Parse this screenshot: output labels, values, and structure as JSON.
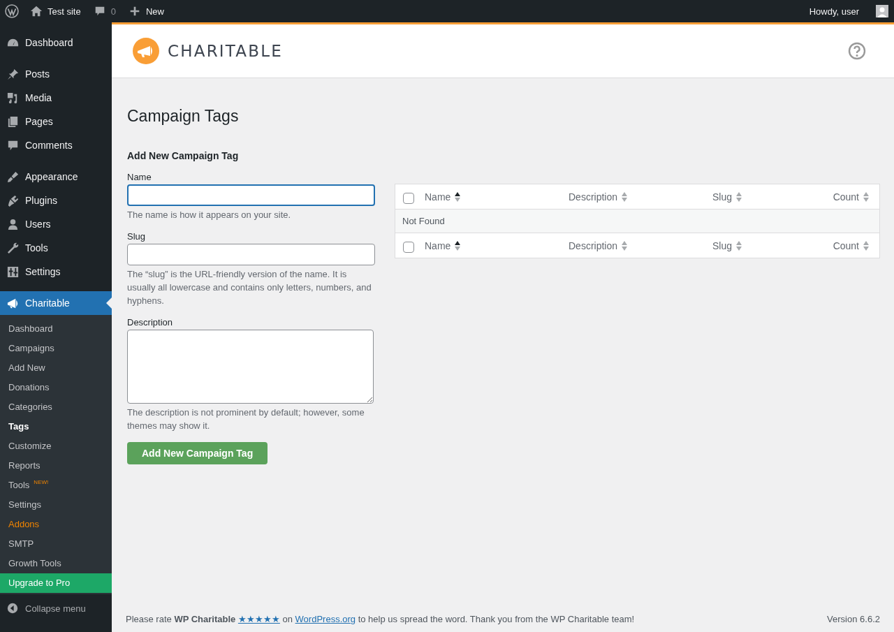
{
  "admin_bar": {
    "site": "Test site",
    "comments": "0",
    "new": "New",
    "greeting": "Howdy, user"
  },
  "menu": {
    "groups": [
      [
        {
          "kind": "dashboard",
          "label": "Dashboard",
          "selected": false
        }
      ],
      [
        {
          "kind": "pin",
          "label": "Posts",
          "selected": false
        },
        {
          "kind": "media",
          "label": "Media",
          "selected": false
        },
        {
          "kind": "pages",
          "label": "Pages",
          "selected": false
        },
        {
          "kind": "comment",
          "label": "Comments",
          "selected": false
        }
      ],
      [
        {
          "kind": "brush",
          "label": "Appearance",
          "selected": false
        },
        {
          "kind": "plug",
          "label": "Plugins",
          "selected": false
        },
        {
          "kind": "user",
          "label": "Users",
          "selected": false
        },
        {
          "kind": "wrench",
          "label": "Tools",
          "selected": false
        },
        {
          "kind": "sliders",
          "label": "Settings",
          "selected": false
        }
      ],
      [
        {
          "kind": "megaphone",
          "label": "Charitable",
          "selected": true
        }
      ]
    ],
    "submenu": [
      {
        "kind": "normal",
        "label": "Dashboard",
        "selected": false
      },
      {
        "kind": "normal",
        "label": "Campaigns",
        "selected": false
      },
      {
        "kind": "normal",
        "label": "Add New",
        "selected": false
      },
      {
        "kind": "normal",
        "label": "Donations",
        "selected": false
      },
      {
        "kind": "normal",
        "label": "Categories",
        "selected": false
      },
      {
        "kind": "normal",
        "label": "Tags",
        "selected": true
      },
      {
        "kind": "normal",
        "label": "Customize",
        "selected": false
      },
      {
        "kind": "normal",
        "label": "Reports",
        "selected": false
      },
      {
        "kind": "normal",
        "label": "Tools",
        "selected": false,
        "badge": "NEW!"
      },
      {
        "kind": "normal",
        "label": "Settings",
        "selected": false
      },
      {
        "kind": "highlight",
        "label": "Addons",
        "selected": false
      },
      {
        "kind": "normal",
        "label": "SMTP",
        "selected": false
      },
      {
        "kind": "normal",
        "label": "Growth Tools",
        "selected": false
      },
      {
        "kind": "upgrade",
        "label": "Upgrade to Pro",
        "selected": false
      }
    ],
    "collapse": "Collapse menu"
  },
  "brand": {
    "name": "CHARITABLE"
  },
  "page_title": "Campaign Tags",
  "form": {
    "heading": "Add New Campaign Tag",
    "fields": [
      {
        "kind": "input",
        "label": "Name",
        "focused": true,
        "hint": "The name is how it appears on your site."
      },
      {
        "kind": "input",
        "label": "Slug",
        "focused": false,
        "hint": "The “slug” is the URL-friendly version of the name. It is usually all lowercase and contains only letters, numbers, and hyphens."
      },
      {
        "kind": "textarea",
        "label": "Description",
        "focused": false,
        "hint": "The description is not prominent by default; however, some themes may show it."
      }
    ],
    "submit": "Add New Campaign Tag"
  },
  "table": {
    "select_all_checked": false,
    "footer_select_all_checked": false,
    "columns": [
      {
        "label": "Name",
        "sorted": true
      },
      {
        "label": "Description",
        "sorted": false
      },
      {
        "label": "Slug",
        "sorted": false
      },
      {
        "label": "Count",
        "sorted": false
      }
    ],
    "empty": "Not Found",
    "footer_columns": [
      {
        "label": "Name",
        "sorted": true
      },
      {
        "label": "Description",
        "sorted": false
      },
      {
        "label": "Slug",
        "sorted": false
      },
      {
        "label": "Count",
        "sorted": false
      }
    ]
  },
  "footer": {
    "parts": [
      {
        "kind": "text",
        "text": "Please rate "
      },
      {
        "kind": "bold",
        "text": "WP Charitable "
      },
      {
        "kind": "link",
        "text": "★★★★★"
      },
      {
        "kind": "text",
        "text": " on "
      },
      {
        "kind": "link",
        "text": "WordPress.org"
      },
      {
        "kind": "text",
        "text": " to help us spread the word. Thank you from the WP Charitable team!"
      }
    ],
    "version": "Version 6.6.2"
  }
}
